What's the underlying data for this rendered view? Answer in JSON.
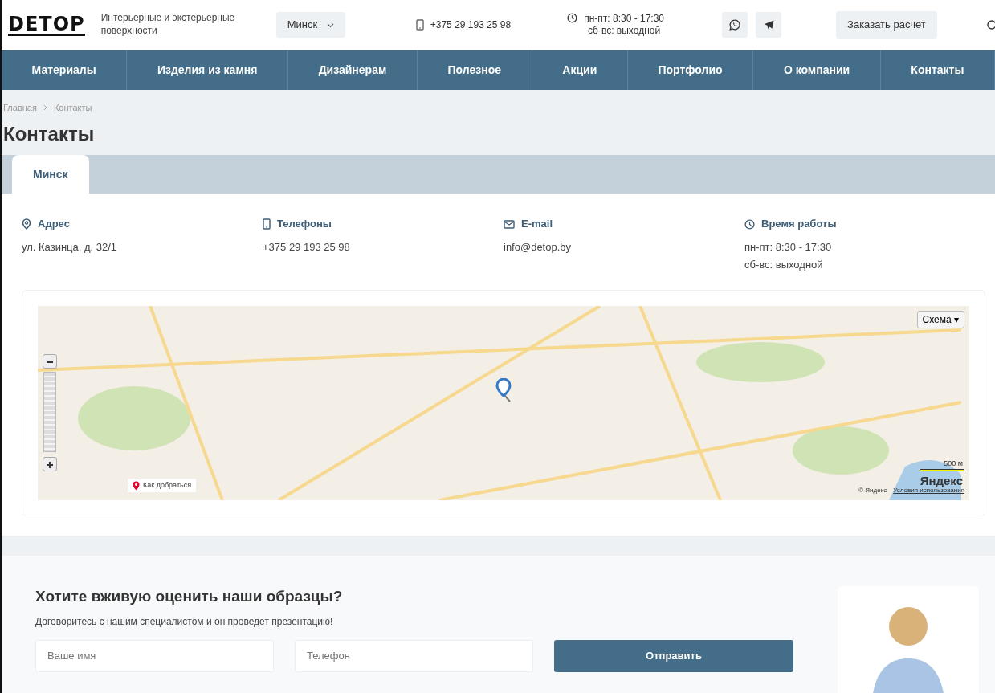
{
  "header": {
    "logo": "DETOP",
    "tagline": "Интерьерные и экстерьерные поверхности",
    "city": "Минск",
    "phone": "+375 29 193 25 98",
    "hours": [
      "пн-пт: 8:30 - 17:30",
      "сб-вс: выходной"
    ],
    "order_button": "Заказать расчет"
  },
  "nav": [
    "Материалы",
    "Изделия из камня",
    "Дизайнерам",
    "Полезное",
    "Акции",
    "Портфолио",
    "О компании",
    "Контакты"
  ],
  "breadcrumbs": [
    "Главная",
    "Контакты"
  ],
  "page_title": "Контакты",
  "tabs": [
    {
      "label": "Минск",
      "selected": true
    }
  ],
  "contacts": [
    {
      "kind": "address",
      "title": "Адрес",
      "lines": [
        "ул. Казинца, д. 32/1"
      ]
    },
    {
      "kind": "phone",
      "title": "Телефоны",
      "lines": [
        "+375 29 193 25 98"
      ]
    },
    {
      "kind": "email",
      "title": "E-mail",
      "lines": [
        "info@detop.by"
      ]
    },
    {
      "kind": "hours",
      "title": "Время работы",
      "lines": [
        "пн-пт: 8:30 - 17:30",
        "сб-вс: выходной"
      ]
    }
  ],
  "map": {
    "layer_button": "Схема ▾",
    "route_link": "Как добраться",
    "scale": "500 м",
    "brand": "Яндекс",
    "copyright": "© Яндекс",
    "terms_link": "Условия использования"
  },
  "callback": {
    "title": "Хотите вживую оценить наши образцы?",
    "subtitle": "Договоритесь с нашим специалистом и он проведет презентацию!",
    "fields": [
      {
        "placeholder": "Ваше имя"
      },
      {
        "placeholder": "Телефон"
      }
    ],
    "submit": "Отправить"
  }
}
